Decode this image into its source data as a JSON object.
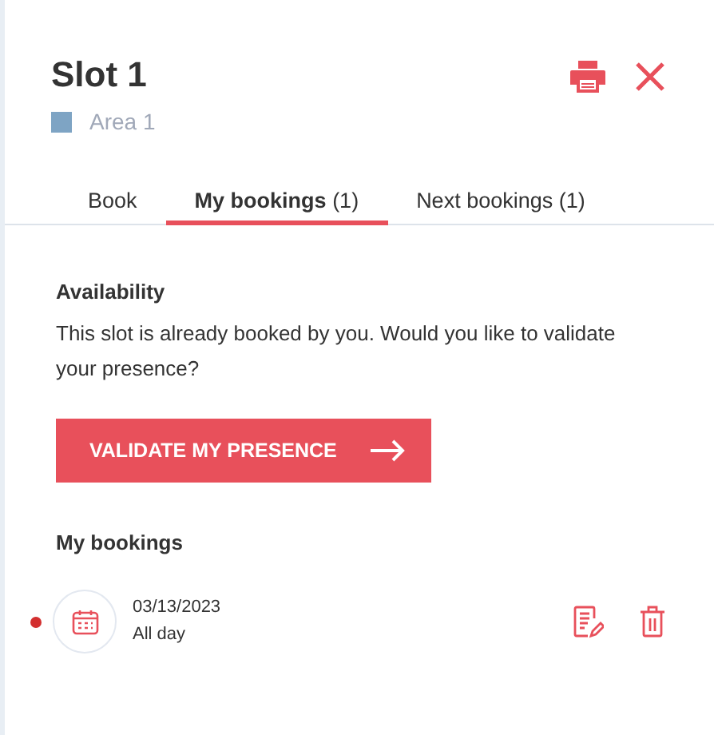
{
  "header": {
    "title": "Slot 1",
    "area": {
      "label": "Area 1",
      "color": "#7ea4c4"
    }
  },
  "tabs": [
    {
      "label": "Book",
      "selected": false
    },
    {
      "label": "My bookings",
      "count": "(1)",
      "selected": true
    },
    {
      "label": "Next bookings",
      "count": "(1)",
      "selected": false
    }
  ],
  "availability": {
    "heading": "Availability",
    "message": "This slot is already booked by you. Would you like to validate your presence?",
    "button": "VALIDATE MY PRESENCE"
  },
  "bookings": {
    "heading": "My bookings",
    "items": [
      {
        "date": "03/13/2023",
        "time": "All day",
        "color": "#d32f2f"
      }
    ]
  }
}
